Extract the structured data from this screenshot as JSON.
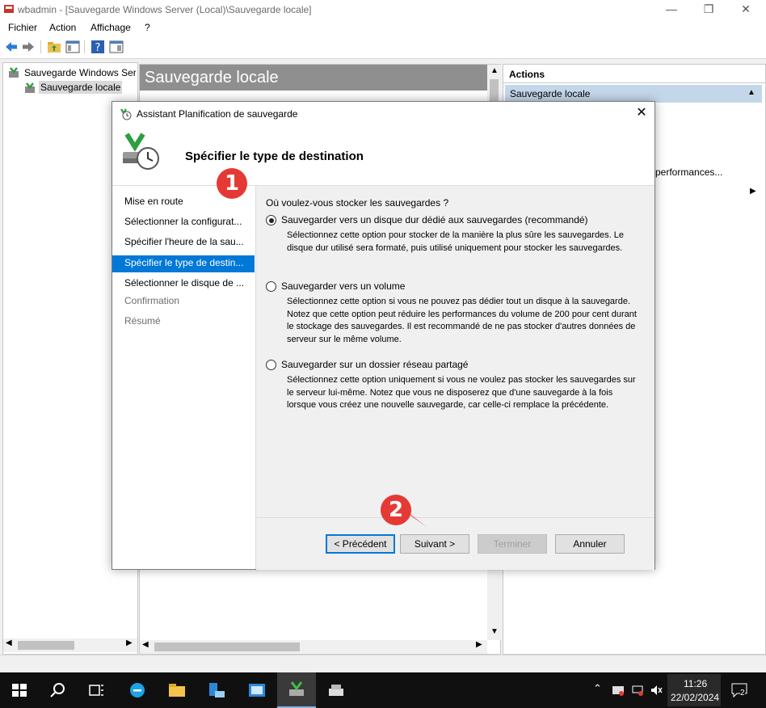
{
  "window": {
    "title": "wbadmin - [Sauvegarde Windows Server (Local)\\Sauvegarde locale]",
    "min": "—",
    "restore": "❐",
    "close": "✕"
  },
  "menu": [
    "Fichier",
    "Action",
    "Affichage",
    "?"
  ],
  "tree": {
    "root": "Sauvegarde Windows Serv",
    "child": "Sauvegarde locale"
  },
  "center": {
    "header": "Sauvegarde locale"
  },
  "actions": {
    "title": "Actions",
    "section": "Sauvegarde locale",
    "partial": "performances..."
  },
  "dialog": {
    "title": "Assistant Planification de sauvegarde",
    "heading": "Spécifier le type de destination",
    "steps": [
      {
        "label": "Mise en route",
        "state": "normal"
      },
      {
        "label": "Sélectionner la configurat...",
        "state": "normal"
      },
      {
        "label": "Spécifier l'heure de la sau...",
        "state": "normal"
      },
      {
        "label": "Spécifier le type de destin...",
        "state": "active"
      },
      {
        "label": "Sélectionner le disque de ...",
        "state": "normal"
      },
      {
        "label": "Confirmation",
        "state": "disabled"
      },
      {
        "label": "Résumé",
        "state": "disabled"
      }
    ],
    "question": "Où voulez-vous stocker les sauvegardes ?",
    "options": [
      {
        "label": "Sauvegarder vers un disque dur dédié aux sauvegardes (recommandé)",
        "desc": "Sélectionnez cette option pour stocker de la manière la plus sûre les sauvegardes. Le disque dur utilisé sera formaté, puis utilisé uniquement pour stocker les sauvegardes.",
        "selected": true
      },
      {
        "label": "Sauvegarder vers un volume",
        "desc": "Sélectionnez cette option si vous ne pouvez pas dédier tout un disque à la sauvegarde. Notez que cette option peut réduire les performances du volume de 200 pour cent durant le stockage des sauvegardes. Il est recommandé de ne pas stocker d'autres données de serveur sur le même volume.",
        "selected": false
      },
      {
        "label": "Sauvegarder sur un dossier réseau partagé",
        "desc": "Sélectionnez cette option uniquement si vous ne voulez pas stocker les sauvegardes sur le serveur lui-même. Notez que vous ne disposerez que d'une sauvegarde à la fois lorsque vous créez une nouvelle sauvegarde, car celle-ci remplace la précédente.",
        "selected": false
      }
    ],
    "buttons": {
      "previous": "< Précédent",
      "next": "Suivant >",
      "finish": "Terminer",
      "cancel": "Annuler"
    },
    "close": "✕"
  },
  "annotations": {
    "badge1": "1",
    "badge2": "2"
  },
  "taskbar": {
    "time": "11:26",
    "date": "22/02/2024",
    "notifications": "2"
  },
  "colors": {
    "accent": "#0078d7",
    "badge": "#e53935",
    "header_gray": "#8f8f8f"
  }
}
